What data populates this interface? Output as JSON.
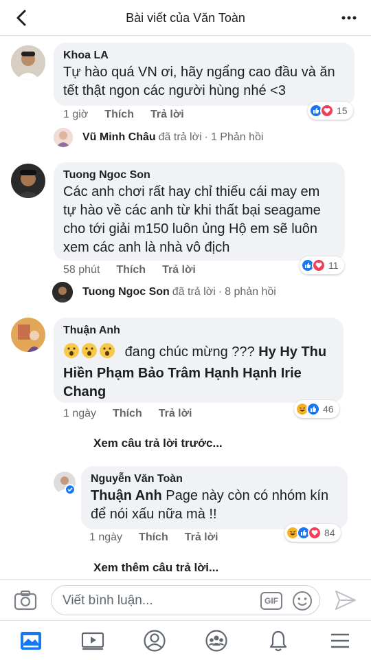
{
  "header": {
    "title": "Bài viết của Văn Toàn"
  },
  "comments": [
    {
      "name": "Khoa LA",
      "text": "Tự hào quá VN ơi, hãy ngẩng cao đầu và ăn tết thật ngon các người hùng nhé <3",
      "time": "1 giờ",
      "like": "Thích",
      "reply": "Trả lời",
      "reaction_count": "15",
      "reply_preview": {
        "name": "Vũ Minh Châu",
        "text": "đã trả lời",
        "sep": "·",
        "count": "1 Phản hồi"
      }
    },
    {
      "name": "Tuong Ngoc Son",
      "text": "Các anh chơi rất hay chỉ thiếu cái may em tự hào về các anh từ khi thất bại seagame cho tới giải m150 luôn ủng Hộ em sẽ luôn xem các anh là nhà vô địch",
      "time": "58 phút",
      "like": "Thích",
      "reply": "Trả lời",
      "reaction_count": "11",
      "reply_preview": {
        "name": "Tuong Ngoc Son",
        "text": "đã trả lời",
        "sep": "·",
        "count": "8 phản hồi"
      }
    },
    {
      "name": "Thuận Anh",
      "text_plain": "đang chúc mừng ???",
      "tags": "Hy Hy Thu Hiền Phạm Bảo Trâm Hạnh Hạnh Irie Chang",
      "time": "1 ngày",
      "like": "Thích",
      "reply": "Trả lời",
      "reaction_count": "46"
    }
  ],
  "see_previous": "Xem câu trả lời trước...",
  "reply": {
    "name": "Nguyễn Văn Toàn",
    "tag": "Thuận Anh",
    "text": "Page này còn có nhóm kín để nói xấu nữa mà !!",
    "time": "1 ngày",
    "like": "Thích",
    "reply": "Trả lời",
    "reaction_count": "84"
  },
  "see_more": "Xem thêm câu trả lời...",
  "composer": {
    "placeholder": "Viết bình luận...",
    "gif_label": "GIF"
  },
  "nav": [
    "news-feed-icon",
    "video-icon",
    "profile-icon",
    "groups-icon",
    "notifications-icon",
    "menu-icon"
  ],
  "colors": {
    "like_blue": "#1877f2",
    "love_red": "#f33e58",
    "haha_yellow": "#f7b125",
    "bubble": "#f0f2f5"
  }
}
